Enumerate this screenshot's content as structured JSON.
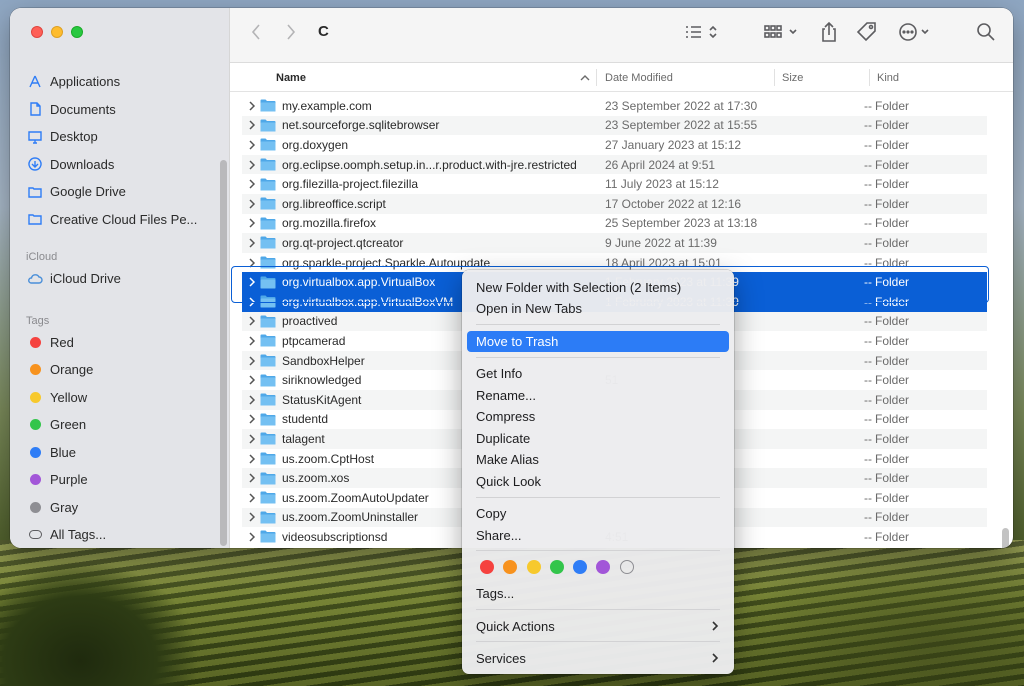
{
  "window": {
    "title": "C"
  },
  "sidebar": {
    "favorites": [
      {
        "label": "Applications",
        "icon": "applications-icon"
      },
      {
        "label": "Documents",
        "icon": "document-icon"
      },
      {
        "label": "Desktop",
        "icon": "desktop-icon"
      },
      {
        "label": "Downloads",
        "icon": "download-icon"
      },
      {
        "label": "Google Drive",
        "icon": "folder-icon"
      },
      {
        "label": "Creative Cloud Files Pe...",
        "icon": "folder-icon"
      }
    ],
    "icloud_header": "iCloud",
    "icloud": [
      {
        "label": "iCloud Drive",
        "icon": "cloud-icon"
      }
    ],
    "tags_header": "Tags",
    "tags": [
      {
        "label": "Red",
        "color": "#f5423f"
      },
      {
        "label": "Orange",
        "color": "#f7921e"
      },
      {
        "label": "Yellow",
        "color": "#f7c92d"
      },
      {
        "label": "Green",
        "color": "#33c54b"
      },
      {
        "label": "Blue",
        "color": "#2f7df6"
      },
      {
        "label": "Purple",
        "color": "#a256d8"
      },
      {
        "label": "Gray",
        "color": "#8e8e93"
      }
    ],
    "all_tags": "All Tags..."
  },
  "columns": {
    "name": "Name",
    "date": "Date Modified",
    "size": "Size",
    "kind": "Kind"
  },
  "rows": [
    {
      "name": "my.example.com",
      "date": "23 September 2022 at 17:30",
      "size": "--",
      "kind": "Folder"
    },
    {
      "name": "net.sourceforge.sqlitebrowser",
      "date": "23 September 2022 at 15:55",
      "size": "--",
      "kind": "Folder"
    },
    {
      "name": "org.doxygen",
      "date": "27 January 2023 at 15:12",
      "size": "--",
      "kind": "Folder"
    },
    {
      "name": "org.eclipse.oomph.setup.in...r.product.with-jre.restricted",
      "date": "26 April 2024 at 9:51",
      "size": "--",
      "kind": "Folder"
    },
    {
      "name": "org.filezilla-project.filezilla",
      "date": "11 July 2023 at 15:12",
      "size": "--",
      "kind": "Folder"
    },
    {
      "name": "org.libreoffice.script",
      "date": "17 October 2022 at 12:16",
      "size": "--",
      "kind": "Folder"
    },
    {
      "name": "org.mozilla.firefox",
      "date": "25 September 2023 at 13:18",
      "size": "--",
      "kind": "Folder"
    },
    {
      "name": "org.qt-project.qtcreator",
      "date": "9 June 2022 at 11:39",
      "size": "--",
      "kind": "Folder"
    },
    {
      "name": "org.sparkle-project.Sparkle.Autoupdate",
      "date": "18 April 2023 at 15:01",
      "size": "--",
      "kind": "Folder"
    },
    {
      "name": "org.virtualbox.app.VirtualBox",
      "date": "1 February 2023 at 11:39",
      "size": "--",
      "kind": "Folder",
      "selected": true
    },
    {
      "name": "org.virtualbox.app.VirtualBoxVM",
      "date": "1 February 2023 at 11:39",
      "size": "--",
      "kind": "Folder",
      "selected": true
    },
    {
      "name": "proactived",
      "date": "",
      "size": "--",
      "kind": "Folder"
    },
    {
      "name": "ptpcamerad",
      "date": "31",
      "size": "--",
      "kind": "Folder"
    },
    {
      "name": "SandboxHelper",
      "date": "",
      "size": "--",
      "kind": "Folder"
    },
    {
      "name": "siriknowledged",
      "date": "51",
      "size": "--",
      "kind": "Folder"
    },
    {
      "name": "StatusKitAgent",
      "date": "",
      "size": "--",
      "kind": "Folder"
    },
    {
      "name": "studentd",
      "date": "",
      "size": "--",
      "kind": "Folder"
    },
    {
      "name": "talagent",
      "date": "",
      "size": "--",
      "kind": "Folder"
    },
    {
      "name": "us.zoom.CptHost",
      "date": "",
      "size": "--",
      "kind": "Folder"
    },
    {
      "name": "us.zoom.xos",
      "date": "",
      "size": "--",
      "kind": "Folder"
    },
    {
      "name": "us.zoom.ZoomAutoUpdater",
      "date": "",
      "size": "--",
      "kind": "Folder"
    },
    {
      "name": "us.zoom.ZoomUninstaller",
      "date": "",
      "size": "--",
      "kind": "Folder"
    },
    {
      "name": "videosubscriptionsd",
      "date": "4:51",
      "size": "--",
      "kind": "Folder"
    }
  ],
  "context_menu": {
    "group1": [
      "New Folder with Selection (2 Items)",
      "Open in New Tabs"
    ],
    "trash": "Move to Trash",
    "group2": [
      "Get Info",
      "Rename...",
      "Compress",
      "Duplicate",
      "Make Alias",
      "Quick Look"
    ],
    "group3": [
      "Copy",
      "Share..."
    ],
    "tag_colors": [
      "#f5423f",
      "#f7921e",
      "#f7c92d",
      "#33c54b",
      "#2f7df6",
      "#a256d8",
      "#ffffff"
    ],
    "tags_item": "Tags...",
    "quick_actions": "Quick Actions",
    "services": "Services"
  },
  "colors": {
    "selection": "#0a5fd6",
    "menu_highlight": "#2c7cf6"
  }
}
